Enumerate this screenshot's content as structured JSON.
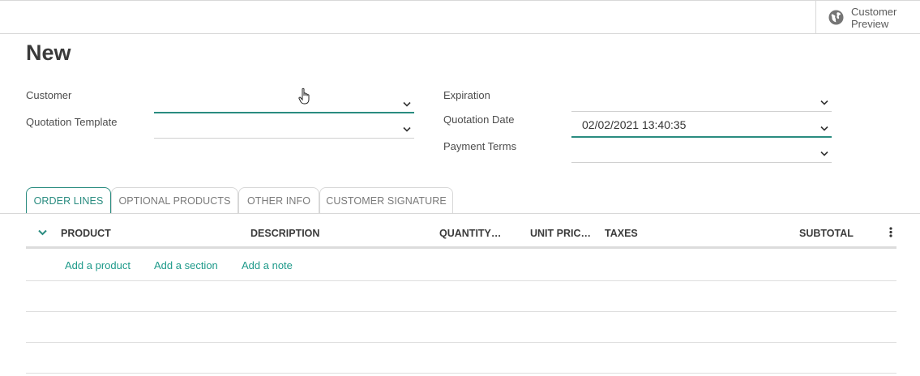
{
  "topbar": {
    "preview_label": "Customer Preview",
    "preview_icon": "globe-icon"
  },
  "title": "New",
  "form": {
    "customer_label": "Customer",
    "customer_value": "",
    "template_label": "Quotation Template",
    "template_value": "",
    "expiration_label": "Expiration",
    "expiration_value": "",
    "quote_date_label": "Quotation Date",
    "quote_date_value": "02/02/2021 13:40:35",
    "payment_terms_label": "Payment Terms",
    "payment_terms_value": ""
  },
  "tabs": [
    "ORDER LINES",
    "OPTIONAL PRODUCTS",
    "OTHER INFO",
    "CUSTOMER SIGNATURE"
  ],
  "table": {
    "headers": {
      "product": "PRODUCT",
      "description": "DESCRIPTION",
      "quantity": "QUANTITY…",
      "unit_price": "UNIT PRIC…",
      "taxes": "TAXES",
      "subtotal": "SUBTOTAL"
    },
    "actions": {
      "add_product": "Add a product",
      "add_section": "Add a section",
      "add_note": "Add a note"
    }
  },
  "colors": {
    "accent": "#2a8c80",
    "link": "#1e9a8a",
    "border": "#d8d8d8"
  }
}
